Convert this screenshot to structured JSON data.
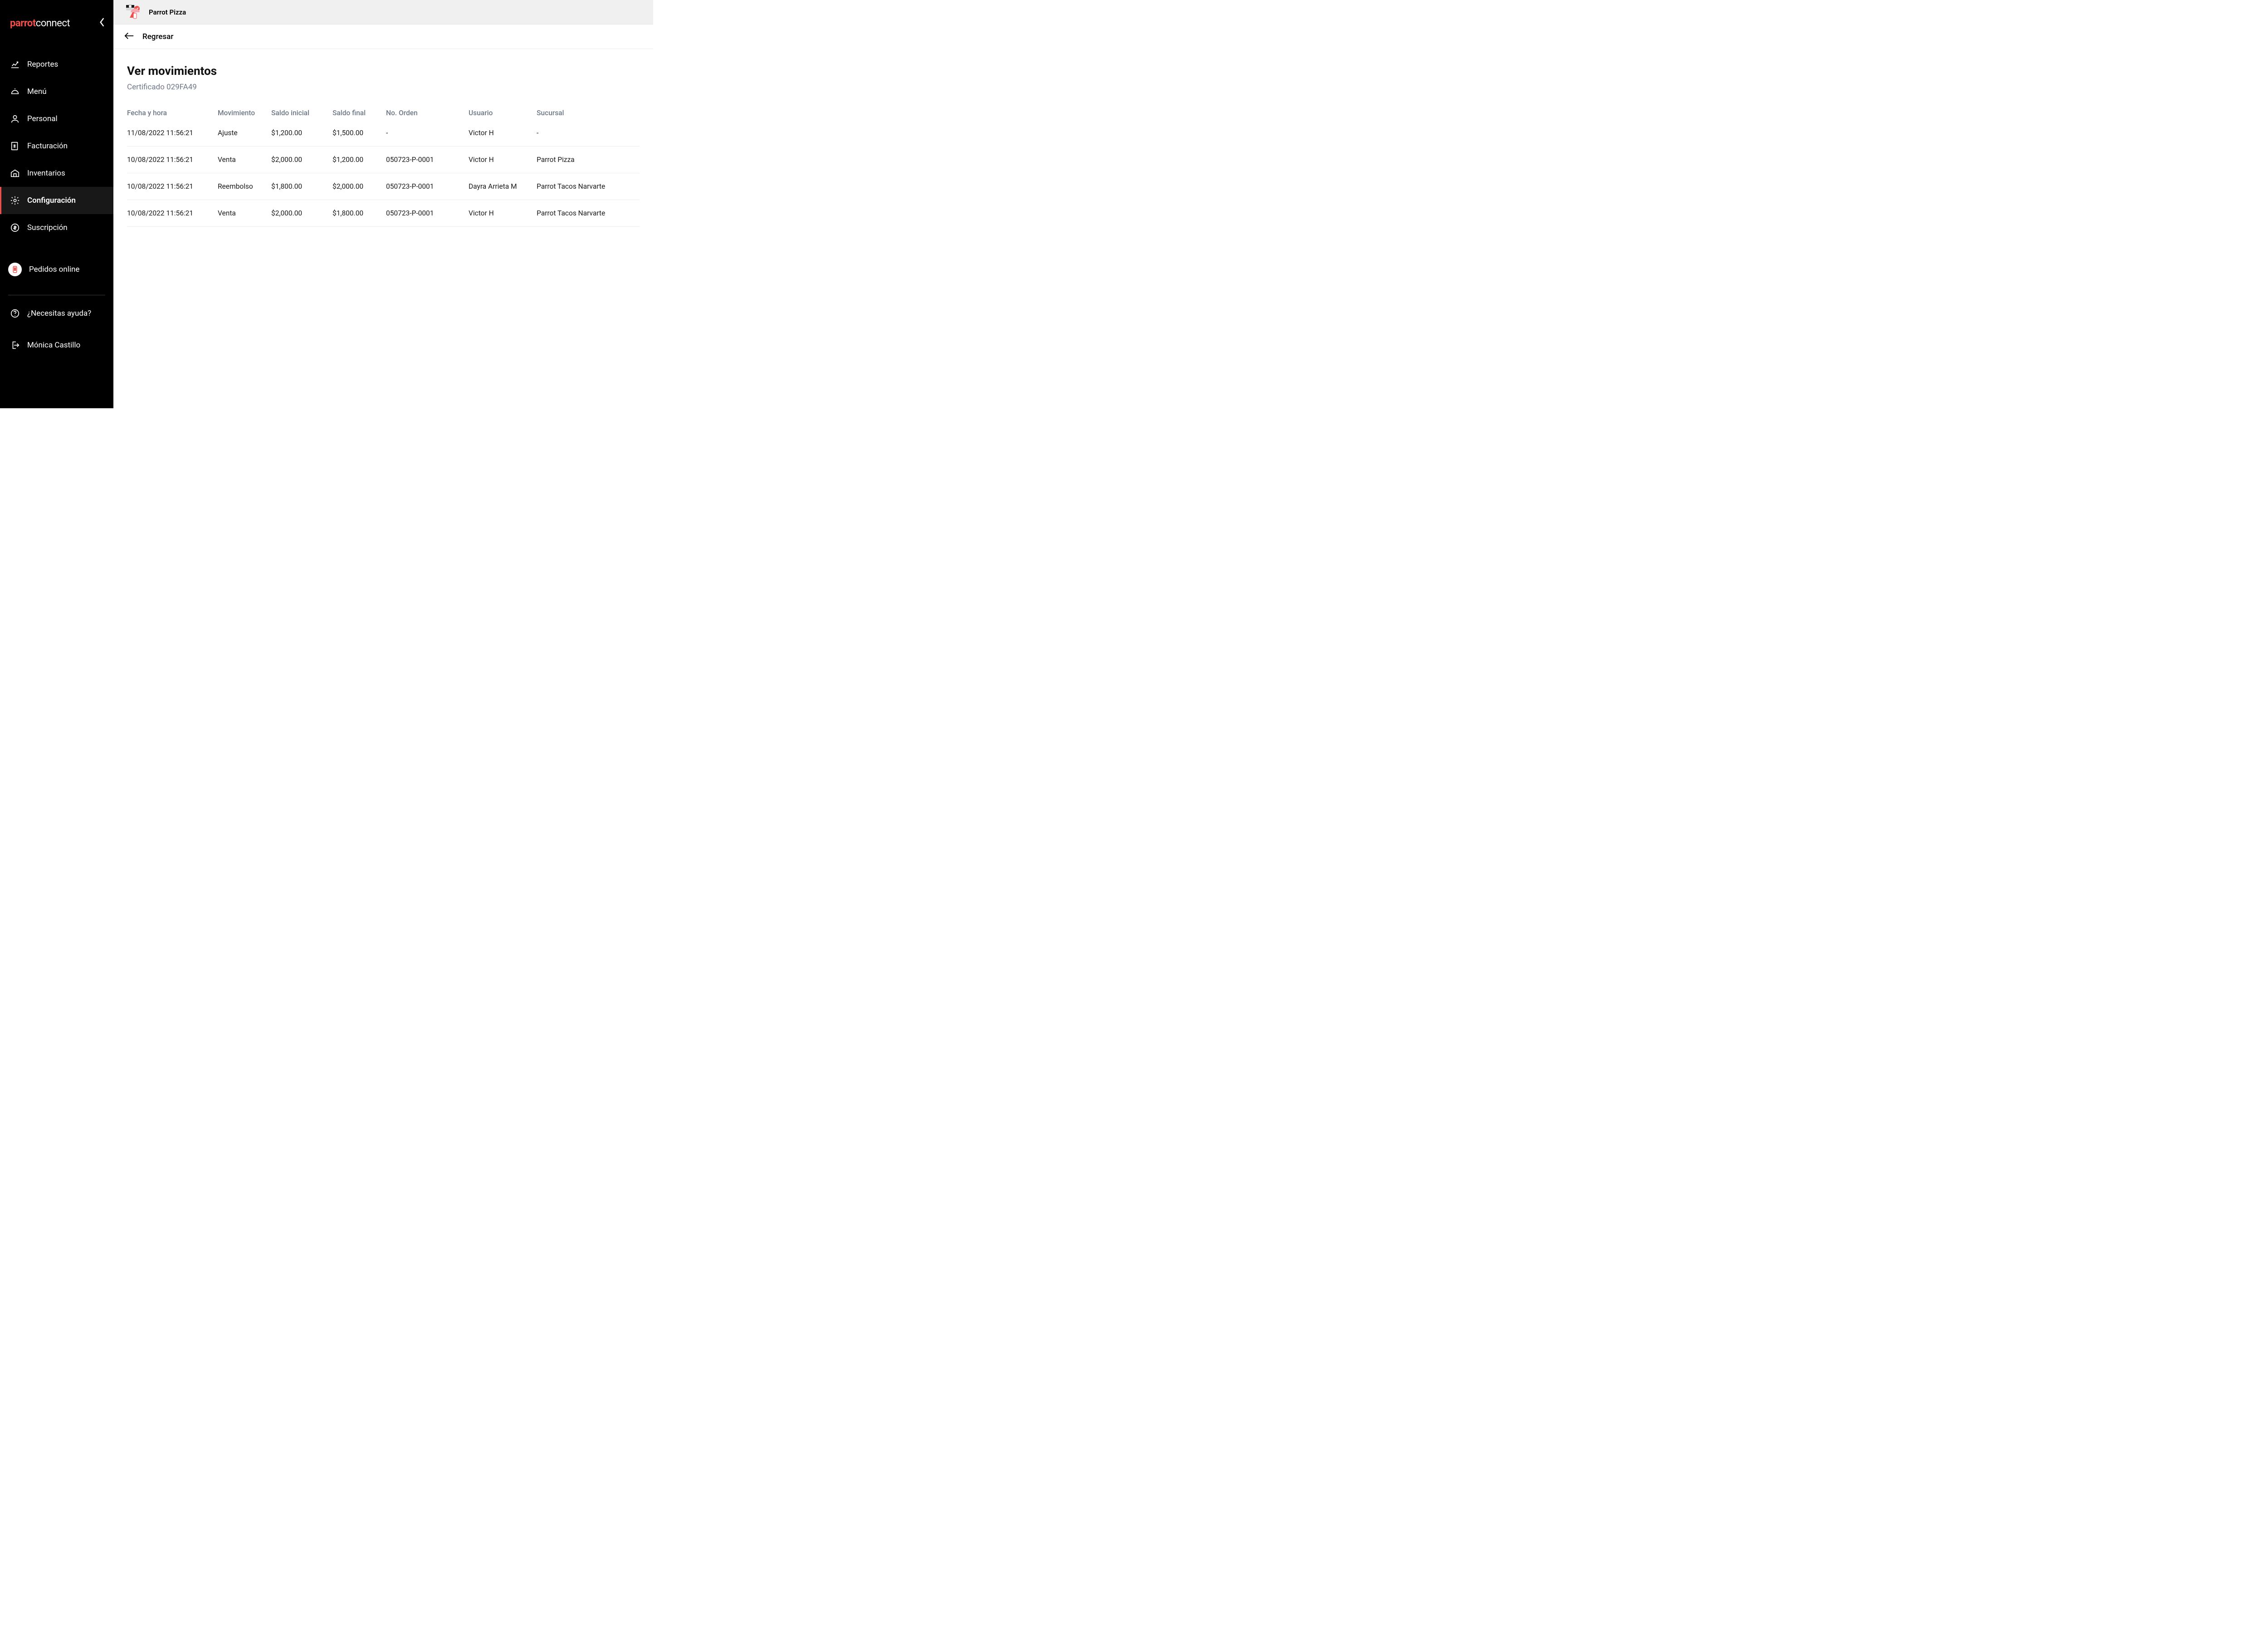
{
  "logo": {
    "part1": "parrot",
    "part2": "connect"
  },
  "sidebar": {
    "items": [
      {
        "key": "reportes",
        "label": "Reportes"
      },
      {
        "key": "menu",
        "label": "Menú"
      },
      {
        "key": "personal",
        "label": "Personal"
      },
      {
        "key": "facturacion",
        "label": "Facturación"
      },
      {
        "key": "inventarios",
        "label": "Inventarios"
      },
      {
        "key": "configuracion",
        "label": "Configuración"
      },
      {
        "key": "suscripcion",
        "label": "Suscripción"
      }
    ],
    "online_label": "Pedidos online",
    "help_label": "¿Necesitas ayuda?",
    "user_label": "Mónica Castillo"
  },
  "header": {
    "store_name": "Parrot Pizza",
    "back_label": "Regresar"
  },
  "page": {
    "title": "Ver movimientos",
    "subtitle": "Certificado 029FA49"
  },
  "table": {
    "headers": {
      "datetime": "Fecha y hora",
      "movement": "Movimiento",
      "initial": "Saldo inicial",
      "final": "Saldo final",
      "order": "No. Orden",
      "user": "Usuario",
      "branch": "Sucursal"
    },
    "rows": [
      {
        "datetime": "11/08/2022 11:56:21",
        "movement": "Ajuste",
        "initial": "$1,200.00",
        "final": "$1,500.00",
        "order": "-",
        "user": "Victor H",
        "branch": "-"
      },
      {
        "datetime": "10/08/2022 11:56:21",
        "movement": "Venta",
        "initial": "$2,000.00",
        "final": "$1,200.00",
        "order": "050723-P-0001",
        "user": "Victor H",
        "branch": "Parrot Pizza"
      },
      {
        "datetime": "10/08/2022 11:56:21",
        "movement": "Reembolso",
        "initial": "$1,800.00",
        "final": "$2,000.00",
        "order": "050723-P-0001",
        "user": "Dayra Arrieta M",
        "branch": "Parrot Tacos Narvarte"
      },
      {
        "datetime": "10/08/2022 11:56:21",
        "movement": "Venta",
        "initial": "$2,000.00",
        "final": "$1,800.00",
        "order": "050723-P-0001",
        "user": "Victor H",
        "branch": "Parrot Tacos Narvarte"
      }
    ]
  }
}
